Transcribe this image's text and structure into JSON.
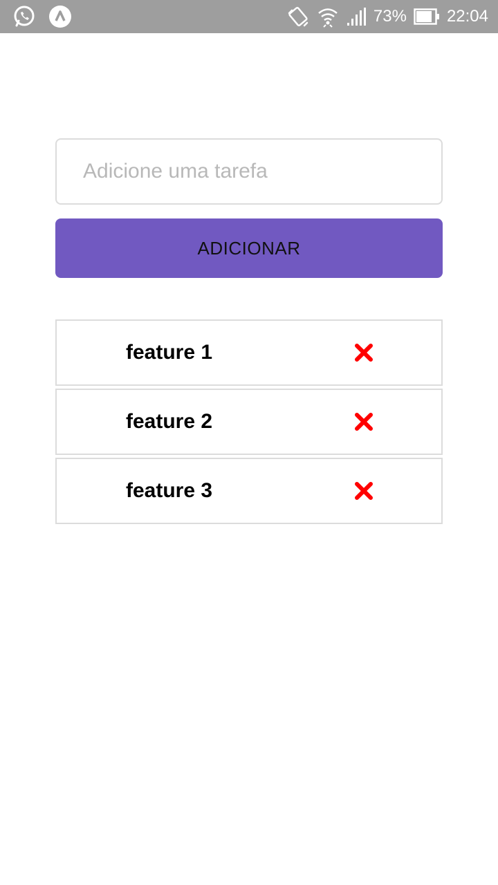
{
  "status_bar": {
    "battery_percent": "73%",
    "time": "22:04",
    "left_icons": [
      "whatsapp-icon",
      "app-a-icon"
    ],
    "right_icons": [
      "vibrate-icon",
      "wifi-icon",
      "signal-icon",
      "battery-icon"
    ]
  },
  "form": {
    "input_placeholder": "Adicione uma tarefa",
    "input_value": "",
    "add_button_label": "ADICIONAR"
  },
  "tasks": [
    {
      "label": "feature 1",
      "delete_icon": "close-icon"
    },
    {
      "label": "feature 2",
      "delete_icon": "close-icon"
    },
    {
      "label": "feature 3",
      "delete_icon": "close-icon"
    }
  ],
  "colors": {
    "status_bar": "#9e9e9e",
    "accent": "#7159c1",
    "delete": "#ff0000",
    "border": "#dcdcdc"
  }
}
